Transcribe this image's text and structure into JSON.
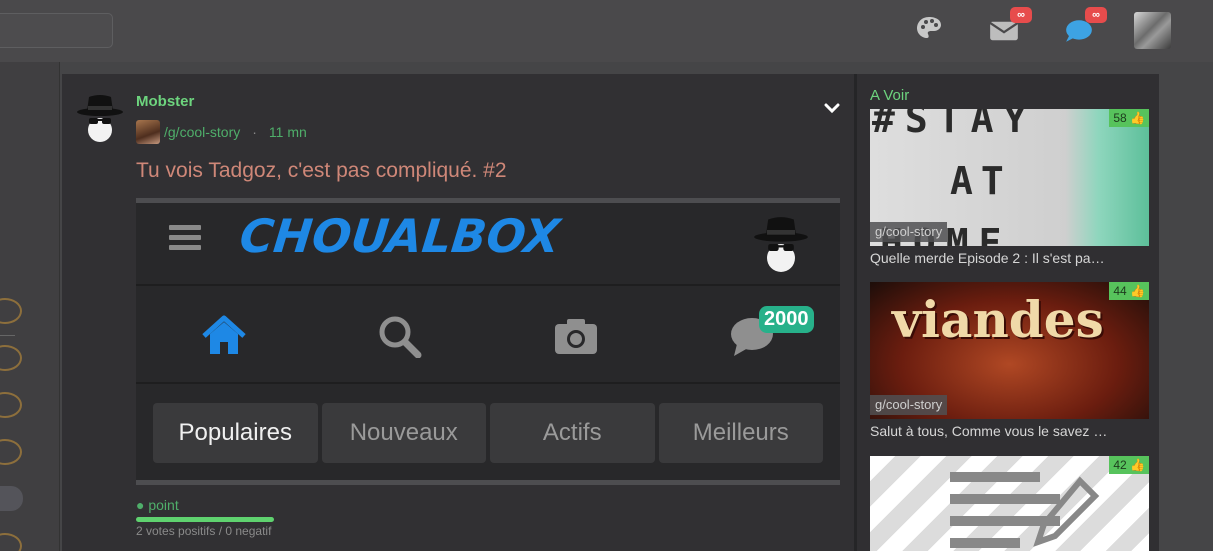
{
  "topbar": {
    "mail_badge": "∞",
    "chat_badge": "∞"
  },
  "post": {
    "author": "Mobster",
    "group": "/g/cool-story",
    "separator": "·",
    "time": "11 mn",
    "title": "Tu vois Tadgoz, c'est pas compliqué. #2",
    "embed": {
      "logo": "CHOUALBOX",
      "message_count": "2000",
      "tabs": [
        "Populaires",
        "Nouveaux",
        "Actifs",
        "Meilleurs"
      ],
      "active_tab": "Populaires"
    },
    "points_label": "● point",
    "votes_text": "2 votes positifs / 0 negatif"
  },
  "sidebar": {
    "title": "A Voir",
    "cards": [
      {
        "score": "58",
        "group": "g/cool-story",
        "title": "Quelle merde Episode 2 : Il s'est pa…",
        "thumb_text": [
          "#STAY",
          "AT",
          "HOME"
        ]
      },
      {
        "score": "44",
        "group": "g/cool-story",
        "title": "Salut à tous, Comme vous le savez …",
        "thumb_text": [
          "viandes"
        ]
      },
      {
        "score": "42"
      }
    ]
  },
  "colors": {
    "accent_green": "#6dd47e",
    "title_red": "#cf8778",
    "logo_blue": "#1e88e5",
    "badge_red": "#e74c4c"
  }
}
